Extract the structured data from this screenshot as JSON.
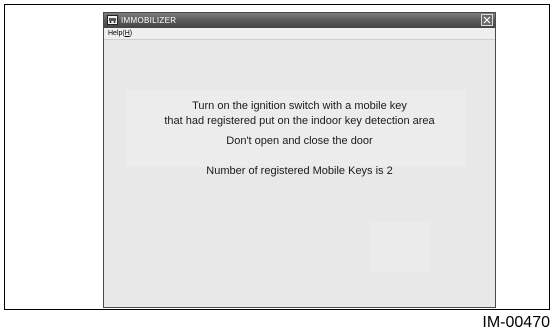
{
  "window": {
    "title": "IMMOBILIZER",
    "close_symbol": "✕",
    "app_icon": "car-key-icon"
  },
  "menu": {
    "help_prefix": "Help(",
    "help_key": "H",
    "help_suffix": ")"
  },
  "messages": {
    "line1": "Turn on the ignition switch with a mobile key",
    "line2": "that had registered put on the indoor key detection area",
    "line3": "Don't open and close the door",
    "line4": "Number of registered Mobile Keys is 2"
  },
  "figure": {
    "reference_id": "IM-00470"
  }
}
